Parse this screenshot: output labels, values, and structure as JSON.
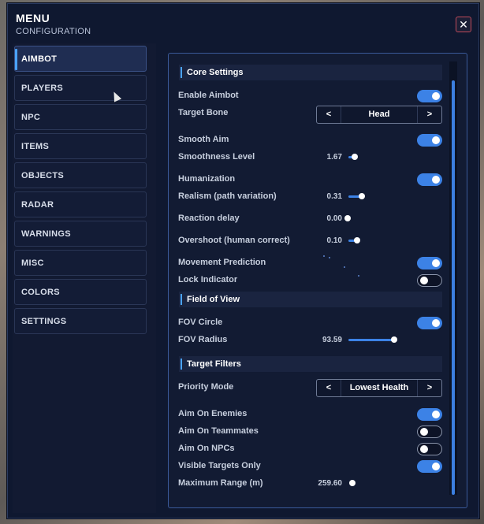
{
  "header": {
    "title": "MENU",
    "subtitle": "CONFIGURATION",
    "close_label": "✕"
  },
  "sidebar": {
    "items": [
      {
        "label": "AIMBOT",
        "active": true
      },
      {
        "label": "PLAYERS"
      },
      {
        "label": "NPC"
      },
      {
        "label": "ITEMS"
      },
      {
        "label": "OBJECTS"
      },
      {
        "label": "RADAR"
      },
      {
        "label": "WARNINGS"
      },
      {
        "label": "MISC"
      },
      {
        "label": "COLORS"
      },
      {
        "label": "SETTINGS"
      }
    ]
  },
  "core": {
    "section_title": "Core Settings",
    "enable_aimbot": {
      "label": "Enable Aimbot",
      "value": true
    },
    "target_bone": {
      "label": "Target Bone",
      "value": "Head",
      "prev": "<",
      "next": ">"
    },
    "smooth_aim": {
      "label": "Smooth Aim",
      "value": true
    },
    "smoothness": {
      "label": "Smoothness Level",
      "value": "1.67"
    },
    "humanization": {
      "label": "Humanization",
      "value": true
    },
    "realism": {
      "label": "Realism (path variation)",
      "value": "0.31"
    },
    "reaction": {
      "label": "Reaction delay",
      "value": "0.00"
    },
    "overshoot": {
      "label": "Overshoot (human correct)",
      "value": "0.10"
    },
    "movement_prediction": {
      "label": "Movement Prediction",
      "value": true
    },
    "lock_indicator": {
      "label": "Lock Indicator",
      "value": false
    }
  },
  "fov": {
    "section_title": "Field of View",
    "fov_circle": {
      "label": "FOV Circle",
      "value": true
    },
    "fov_radius": {
      "label": "FOV Radius",
      "value": "93.59"
    }
  },
  "filters": {
    "section_title": "Target Filters",
    "priority_mode": {
      "label": "Priority Mode",
      "value": "Lowest Health",
      "prev": "<",
      "next": ">"
    },
    "aim_enemies": {
      "label": "Aim On Enemies",
      "value": true
    },
    "aim_teammates": {
      "label": "Aim On Teammates",
      "value": false
    },
    "aim_npcs": {
      "label": "Aim On NPCs",
      "value": false
    },
    "visible_only": {
      "label": "Visible Targets Only",
      "value": true
    },
    "max_range": {
      "label": "Maximum Range (m)",
      "value": "259.60"
    }
  },
  "colors": {
    "accent": "#3c82e6",
    "panel": "#121b33",
    "window": "#0f1830",
    "close_border": "#c04a5a"
  }
}
